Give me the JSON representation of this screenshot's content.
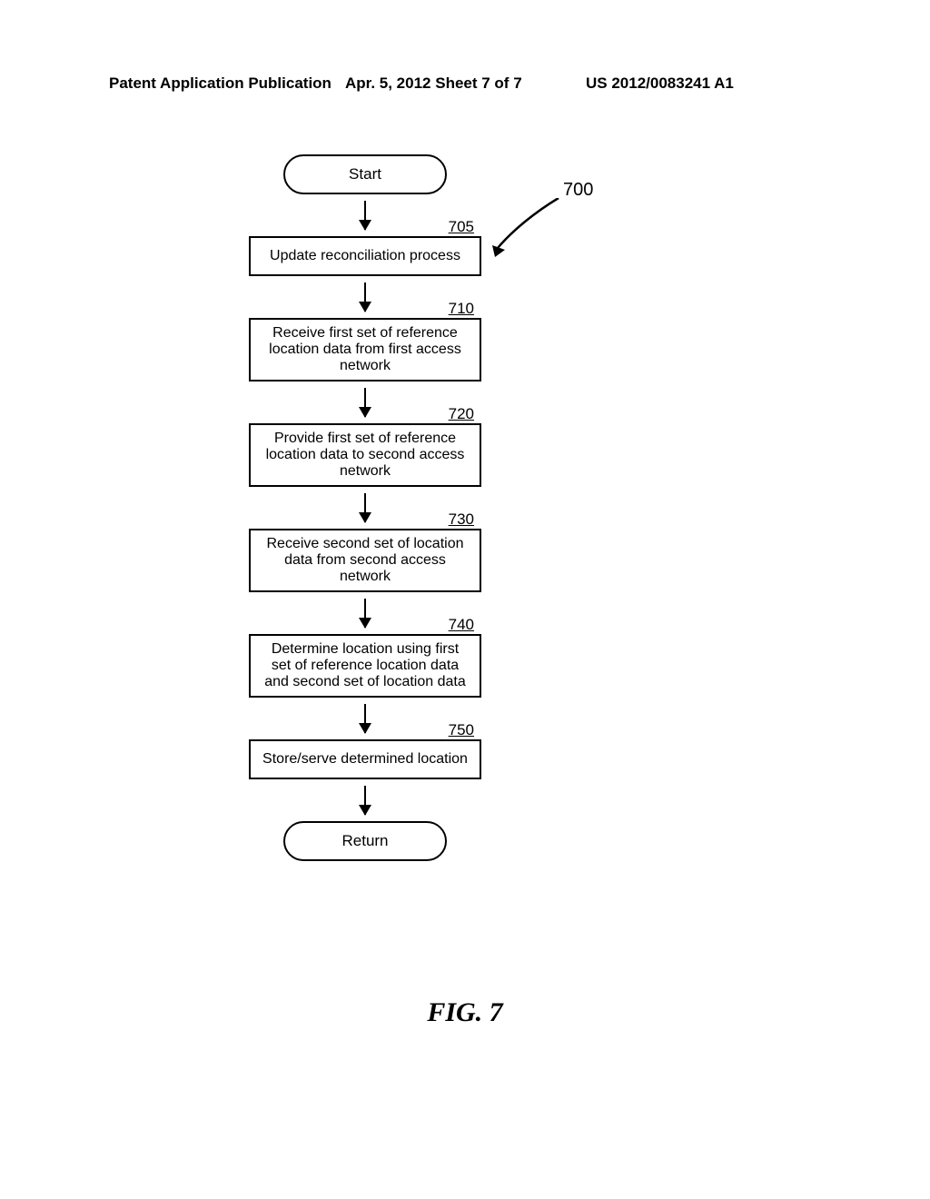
{
  "header": {
    "left": "Patent Application Publication",
    "center": "Apr. 5, 2012  Sheet 7 of 7",
    "right": "US 2012/0083241 A1"
  },
  "callout": {
    "number": "700"
  },
  "flowchart": {
    "start": "Start",
    "return": "Return",
    "steps": [
      {
        "num": "705",
        "text": "Update reconciliation process"
      },
      {
        "num": "710",
        "text": "Receive first set of reference location data from first access network"
      },
      {
        "num": "720",
        "text": "Provide first set of reference location data to second access network"
      },
      {
        "num": "730",
        "text": "Receive second set of location data from second access network"
      },
      {
        "num": "740",
        "text": "Determine location using first set of reference location data and second set of location data"
      },
      {
        "num": "750",
        "text": "Store/serve determined location"
      }
    ]
  },
  "figure_label": "FIG. 7"
}
